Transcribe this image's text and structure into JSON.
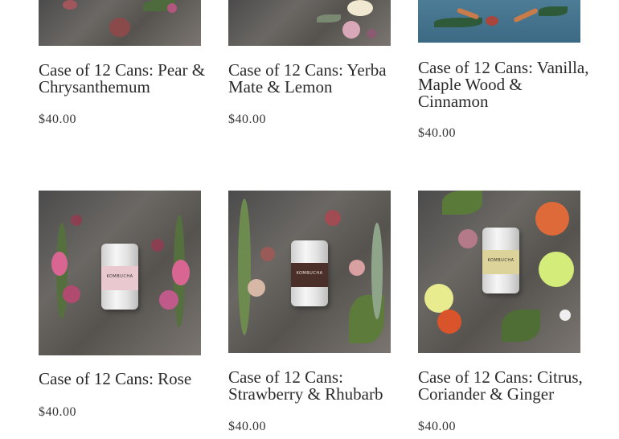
{
  "products": [
    {
      "title": "Case of 12 Cans: Pear & Chrysanthemum",
      "price": "$40.00"
    },
    {
      "title": "Case of 12 Cans: Yerba Mate & Lemon",
      "price": "$40.00"
    },
    {
      "title": "Case of 12 Cans: Vanilla, Maple Wood & Cinnamon",
      "price": "$40.00"
    },
    {
      "title": "Case of 12 Cans: Rose",
      "price": "$40.00",
      "can_label": "KOMBUCHA"
    },
    {
      "title": "Case of 12 Cans: Strawberry & Rhubarb",
      "price": "$40.00",
      "can_label": "KOMBUCHA"
    },
    {
      "title": "Case of 12 Cans: Citrus, Coriander & Ginger",
      "price": "$40.00",
      "can_label": "KOMBUCHA"
    }
  ],
  "colors": {
    "background": "#ffffff",
    "text": "#2b2b2b",
    "slate": "#5e5b57",
    "blue_backdrop": "#467490"
  }
}
